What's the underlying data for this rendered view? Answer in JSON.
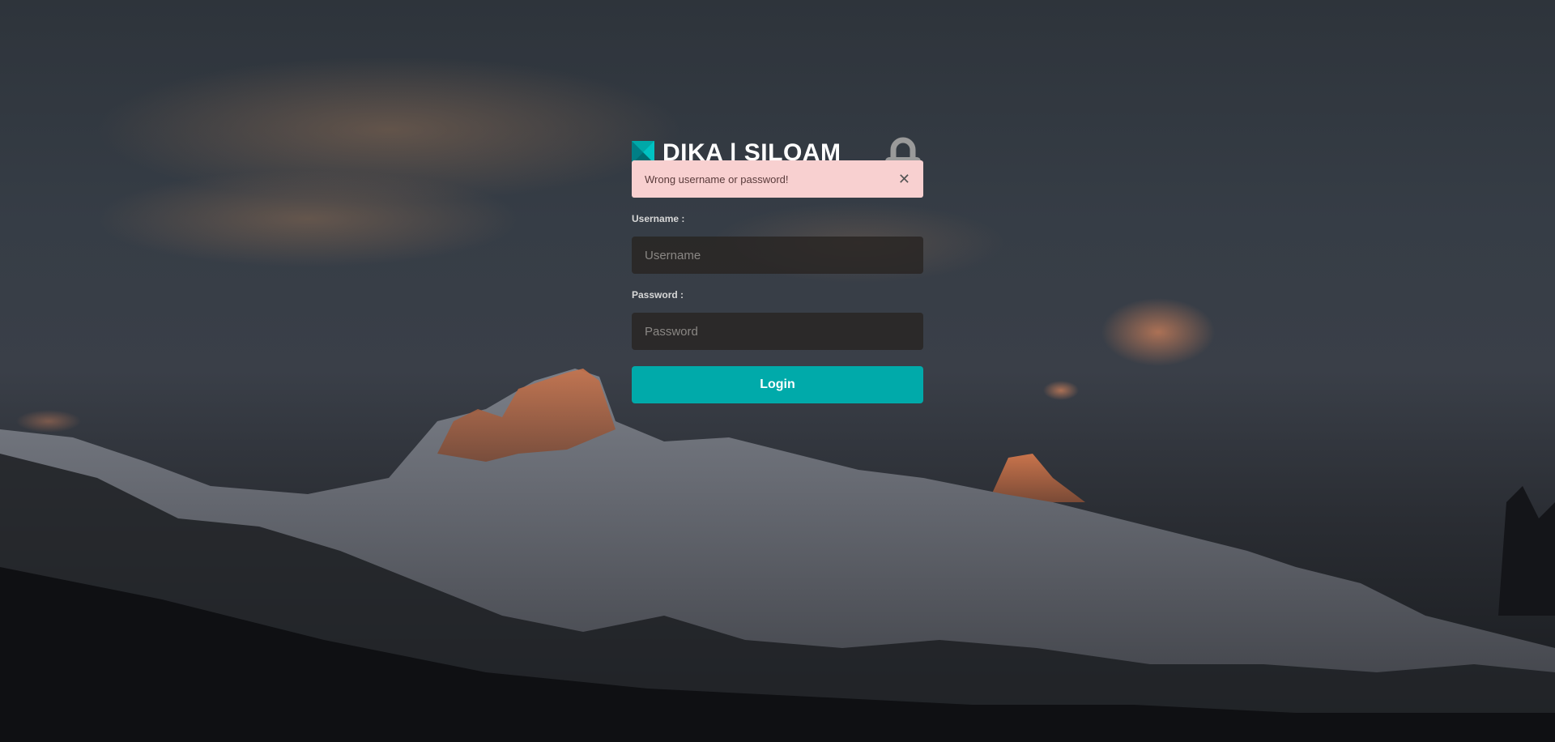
{
  "brand": {
    "title": "DIKA | SILOAM",
    "accent_color": "#00aaaa"
  },
  "alert": {
    "message": "Wrong username or password!",
    "close_glyph": "✕",
    "background_color": "#f8d0d0"
  },
  "form": {
    "username_label": "Username :",
    "username_placeholder": "Username",
    "username_value": "",
    "password_label": "Password :",
    "password_placeholder": "Password",
    "password_value": "",
    "login_label": "Login"
  },
  "icons": {
    "brand": "teal-square-logo-icon",
    "lock": "padlock-icon",
    "close": "close-icon"
  }
}
